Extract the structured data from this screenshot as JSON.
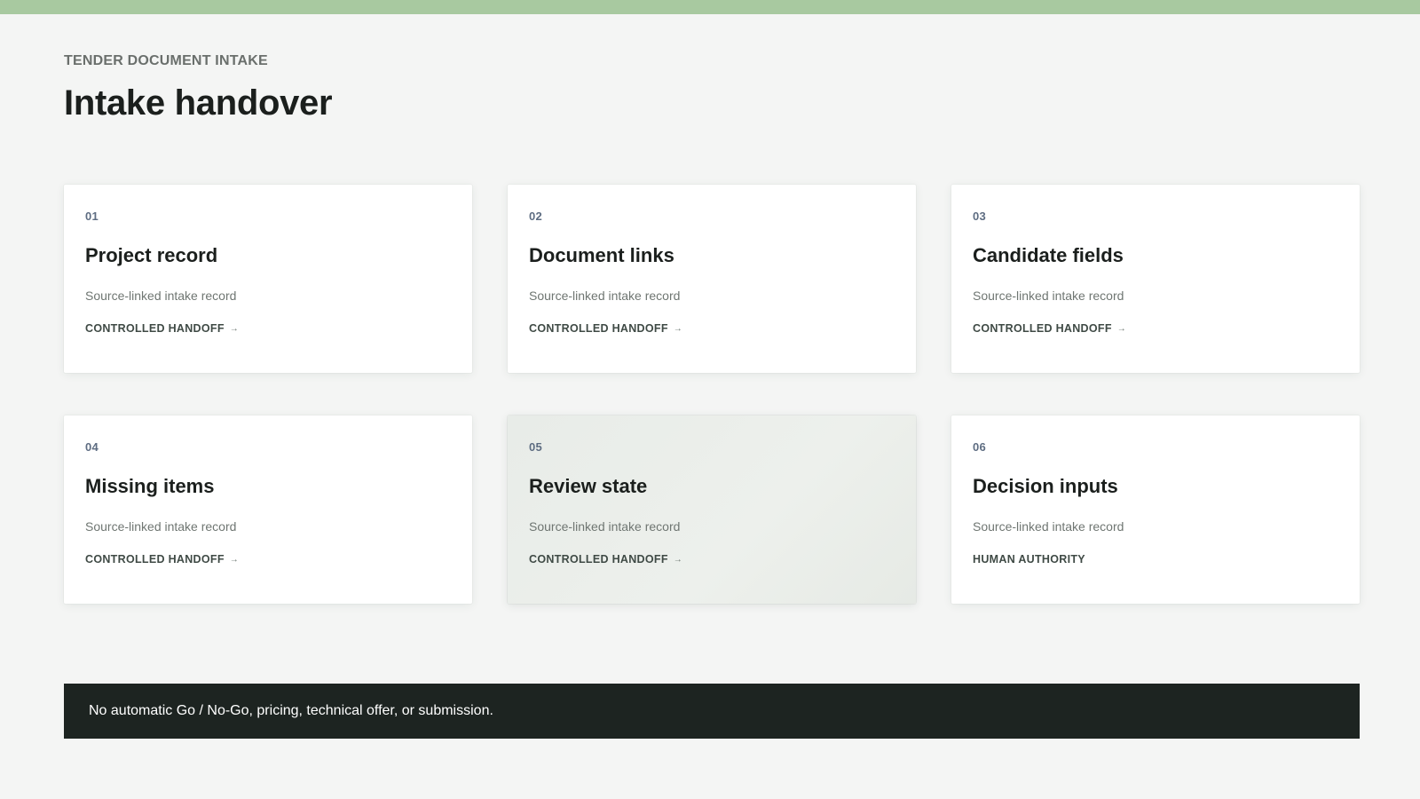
{
  "header": {
    "eyebrow": "TENDER DOCUMENT INTAKE",
    "title": "Intake handover"
  },
  "cards": [
    {
      "number": "01",
      "title": "Project record",
      "description": "Source-linked intake record",
      "link_label": "CONTROLLED HANDOFF",
      "arrow": "→",
      "active": false
    },
    {
      "number": "02",
      "title": "Document links",
      "description": "Source-linked intake record",
      "link_label": "CONTROLLED HANDOFF",
      "arrow": "→",
      "active": false
    },
    {
      "number": "03",
      "title": "Candidate fields",
      "description": "Source-linked intake record",
      "link_label": "CONTROLLED HANDOFF",
      "arrow": "→",
      "active": false
    },
    {
      "number": "04",
      "title": "Missing items",
      "description": "Source-linked intake record",
      "link_label": "CONTROLLED HANDOFF",
      "arrow": "→",
      "active": false
    },
    {
      "number": "05",
      "title": "Review state",
      "description": "Source-linked intake record",
      "link_label": "CONTROLLED HANDOFF",
      "arrow": "→",
      "active": true
    },
    {
      "number": "06",
      "title": "Decision inputs",
      "description": "Source-linked intake record",
      "link_label": "HUMAN AUTHORITY",
      "arrow": "",
      "active": false
    }
  ],
  "notice": {
    "text": "No automatic Go / No-Go, pricing, technical offer, or submission."
  },
  "colors": {
    "accent_bar": "#a8c9a0",
    "background": "#f4f5f4",
    "notice_background": "#1d2421",
    "card_number": "#5e6d82"
  }
}
